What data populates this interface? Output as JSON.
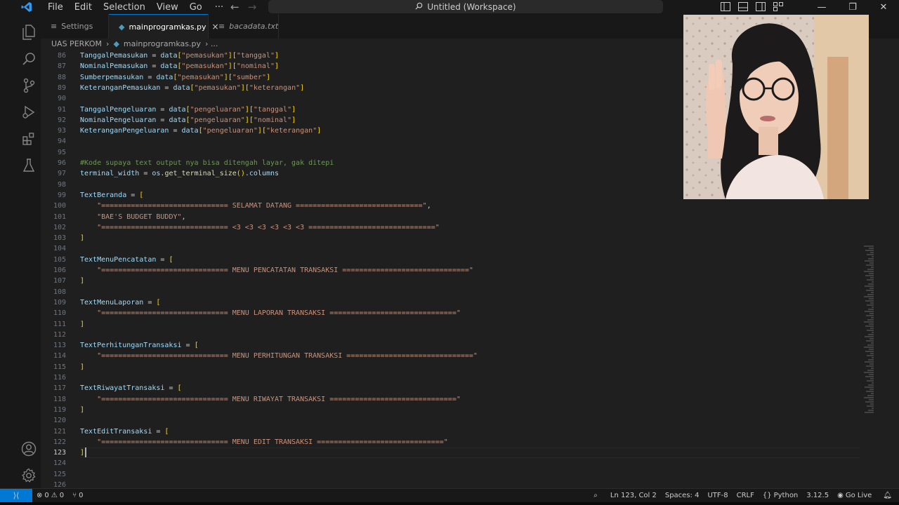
{
  "menu": {
    "file": "File",
    "edit": "Edit",
    "selection": "Selection",
    "view": "View",
    "go": "Go",
    "more": "···"
  },
  "title": "Untitled (Workspace)",
  "tabs": [
    {
      "label": "Settings"
    },
    {
      "label": "mainprogramkas.py",
      "close": "×"
    },
    {
      "label": "bacadata.txt"
    }
  ],
  "breadcrumb": {
    "folder": "UAS PERKOM",
    "sep": "›",
    "file": "mainprogramkas.py",
    "more": "› ..."
  },
  "code_lines": [
    {
      "n": "86",
      "t": "TanggalPemasukan = data[\"pemasukan\"][\"tanggal\"]"
    },
    {
      "n": "87",
      "t": "NominalPemasukan = data[\"pemasukan\"][\"nominal\"]"
    },
    {
      "n": "88",
      "t": "Sumberpemasukan = data[\"pemasukan\"][\"sumber\"]"
    },
    {
      "n": "89",
      "t": "KeteranganPemasukan = data[\"pemasukan\"][\"keterangan\"]"
    },
    {
      "n": "90",
      "t": ""
    },
    {
      "n": "91",
      "t": "TanggalPengeluaran = data[\"pengeluaran\"][\"tanggal\"]"
    },
    {
      "n": "92",
      "t": "NominalPengeluaran = data[\"pengeluaran\"][\"nominal\"]"
    },
    {
      "n": "93",
      "t": "KeteranganPengeluaran = data[\"pengeluaran\"][\"keterangan\"]"
    },
    {
      "n": "94",
      "t": ""
    },
    {
      "n": "95",
      "t": ""
    },
    {
      "n": "96",
      "t": "#Kode supaya text output nya bisa ditengah layar, gak ditepi"
    },
    {
      "n": "97",
      "t": "terminal_width = os.get_terminal_size().columns"
    },
    {
      "n": "98",
      "t": ""
    },
    {
      "n": "99",
      "t": "TextBeranda = ["
    },
    {
      "n": "100",
      "t": "    \"============================== SELAMAT DATANG ==============================\","
    },
    {
      "n": "101",
      "t": "    \"BAE'S BUDGET BUDDY\","
    },
    {
      "n": "102",
      "t": "    \"============================== <3 <3 <3 <3 <3 <3 ==============================\""
    },
    {
      "n": "103",
      "t": "]"
    },
    {
      "n": "104",
      "t": ""
    },
    {
      "n": "105",
      "t": "TextMenuPencatatan = ["
    },
    {
      "n": "106",
      "t": "    \"============================== MENU PENCATATAN TRANSAKSI ==============================\""
    },
    {
      "n": "107",
      "t": "]"
    },
    {
      "n": "108",
      "t": ""
    },
    {
      "n": "109",
      "t": "TextMenuLaporan = ["
    },
    {
      "n": "110",
      "t": "    \"============================== MENU LAPORAN TRANSAKSI ==============================\""
    },
    {
      "n": "111",
      "t": "]"
    },
    {
      "n": "112",
      "t": ""
    },
    {
      "n": "113",
      "t": "TextPerhitunganTransaksi = ["
    },
    {
      "n": "114",
      "t": "    \"============================== MENU PERHITUNGAN TRANSAKSI ==============================\""
    },
    {
      "n": "115",
      "t": "]"
    },
    {
      "n": "116",
      "t": ""
    },
    {
      "n": "117",
      "t": "TextRiwayatTransaksi = ["
    },
    {
      "n": "118",
      "t": "    \"============================== MENU RIWAYAT TRANSAKSI ==============================\""
    },
    {
      "n": "119",
      "t": "]"
    },
    {
      "n": "120",
      "t": ""
    },
    {
      "n": "121",
      "t": "TextEditTransaksi = ["
    },
    {
      "n": "122",
      "t": "    \"============================== MENU EDIT TRANSAKSI ==============================\""
    },
    {
      "n": "123",
      "t": "]"
    },
    {
      "n": "124",
      "t": ""
    },
    {
      "n": "125",
      "t": ""
    },
    {
      "n": "126",
      "t": ""
    }
  ],
  "current_line": "123",
  "status": {
    "errors": "0",
    "warnings": "0",
    "ports": "0",
    "position": "Ln 123, Col 2",
    "spaces": "Spaces: 4",
    "encoding": "UTF-8",
    "eol": "CRLF",
    "language": "Python",
    "version": "3.12.5",
    "golive": "Go Live"
  },
  "colors": {
    "accent": "#0078d4",
    "bg": "#1f1f1f",
    "variable": "#9cdcfe",
    "string": "#ce9178",
    "comment": "#6a9955",
    "bracket": "#ffd700"
  }
}
